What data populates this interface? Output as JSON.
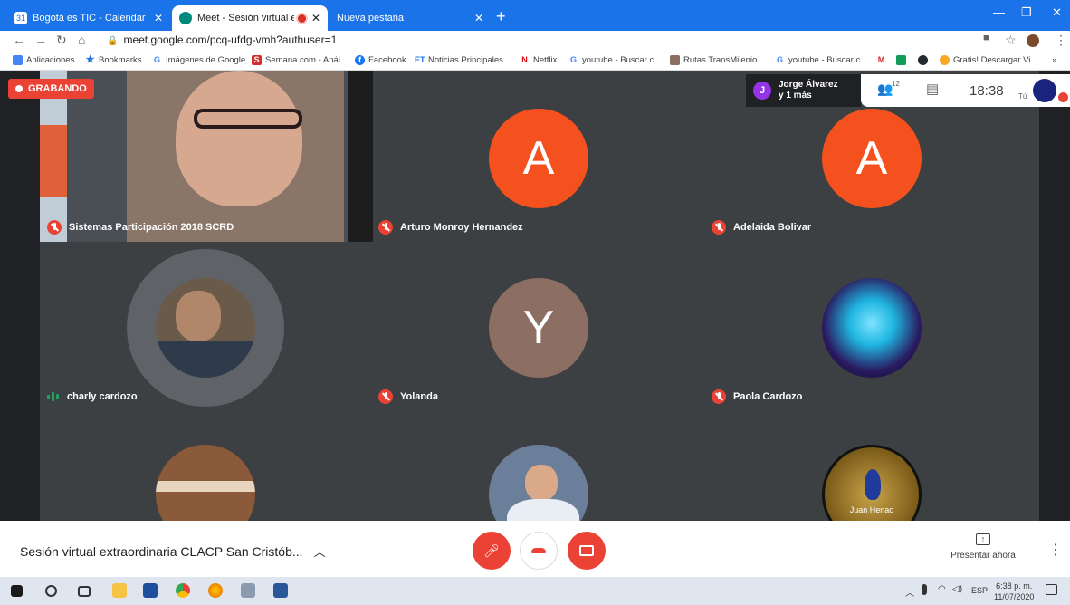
{
  "browser": {
    "tabs": [
      {
        "title": "Bogotá es TIC - Calendar - sábad",
        "active": false
      },
      {
        "title": "Meet - Sesión virtual extraor",
        "active": true
      },
      {
        "title": "Nueva pestaña",
        "active": false
      }
    ],
    "url": "meet.google.com/pcq-ufdg-vmh?authuser=1",
    "bookmarks": [
      "Aplicaciones",
      "Bookmarks",
      "Imágenes de Google",
      "Semana.com - Anál...",
      "Facebook",
      "Noticias Principales...",
      "Netflix",
      "youtube - Buscar c...",
      "Rutas TransMilenio...",
      "youtube - Buscar c...",
      "Gratis! Descargar Vi..."
    ],
    "more_label": "»"
  },
  "meet": {
    "recording_label": "GRABANDO",
    "join_notice": {
      "avatar_letter": "J",
      "line1": "Jorge Álvarez",
      "line2": "y 1 más"
    },
    "participants_count": "12",
    "clock": "18:38",
    "you_label": "Tú",
    "tiles": [
      {
        "name": "Sistemas Participación 2018 SCRD",
        "muted": true,
        "avatar": ""
      },
      {
        "name": "Arturo Monroy Hernandez",
        "muted": true,
        "avatar": "A"
      },
      {
        "name": "Adelaida Bolivar",
        "muted": true,
        "avatar": "A"
      },
      {
        "name": "charly cardozo",
        "muted": false,
        "avatar": ""
      },
      {
        "name": "Yolanda",
        "muted": true,
        "avatar": "Y"
      },
      {
        "name": "Paola Cardozo",
        "muted": true,
        "avatar": ""
      },
      {
        "name": "",
        "muted": true,
        "avatar": ""
      },
      {
        "name": "",
        "muted": true,
        "avatar": ""
      },
      {
        "name": "Juan Henao",
        "muted": true,
        "avatar": ""
      }
    ],
    "meeting_title": "Sesión virtual extraordinaria CLACP San Cristób...",
    "present_label": "Presentar ahora",
    "colors": {
      "orange": "#f4511e",
      "brown": "#8d6e63",
      "red": "#ea4335",
      "tile": "#3c4043"
    }
  },
  "taskbar": {
    "lang": "ESP",
    "time": "6:38 p. m.",
    "date": "11/07/2020"
  }
}
